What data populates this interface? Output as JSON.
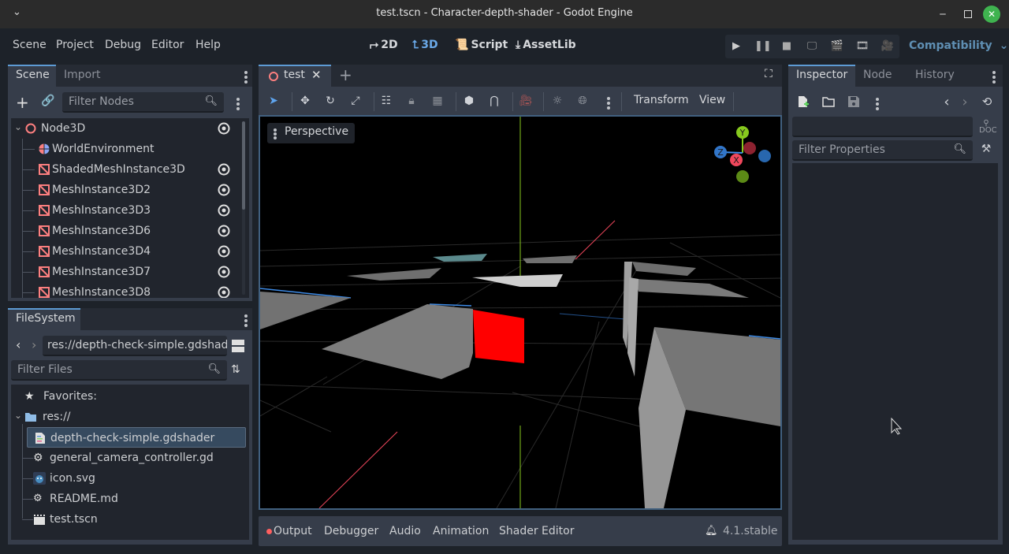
{
  "window": {
    "title": "test.tscn - Character-depth-shader - Godot Engine",
    "controls": {
      "minimize": "‒",
      "maximize": "☐",
      "close": "✕"
    }
  },
  "menubar": {
    "items": [
      "Scene",
      "Project",
      "Debug",
      "Editor",
      "Help"
    ],
    "workspaces": [
      {
        "label": "2D",
        "icon": "2d-icon",
        "active": false
      },
      {
        "label": "3D",
        "icon": "3d-icon",
        "active": true
      },
      {
        "label": "Script",
        "icon": "script-icon",
        "active": false
      },
      {
        "label": "AssetLib",
        "icon": "download-icon",
        "active": false
      }
    ],
    "run_buttons": [
      "play-icon",
      "pause-icon",
      "stop-icon",
      "remote-debug-icon",
      "play-scene-icon",
      "play-custom-scene-icon",
      "movie-maker-icon"
    ],
    "renderer": "Compatibility"
  },
  "scene_dock": {
    "tabs": [
      "Scene",
      "Import"
    ],
    "active_tab": "Scene",
    "filter_placeholder": "Filter Nodes",
    "nodes": [
      {
        "name": "Node3D",
        "icon": "node3d-icon",
        "visible_toggle": true,
        "root": true
      },
      {
        "name": "WorldEnvironment",
        "icon": "world-environment-icon",
        "visible_toggle": false
      },
      {
        "name": "ShadedMeshInstance3D",
        "icon": "mesh-instance-icon",
        "visible_toggle": true
      },
      {
        "name": "MeshInstance3D2",
        "icon": "mesh-instance-icon",
        "visible_toggle": true
      },
      {
        "name": "MeshInstance3D3",
        "icon": "mesh-instance-icon",
        "visible_toggle": true
      },
      {
        "name": "MeshInstance3D6",
        "icon": "mesh-instance-icon",
        "visible_toggle": true
      },
      {
        "name": "MeshInstance3D4",
        "icon": "mesh-instance-icon",
        "visible_toggle": true
      },
      {
        "name": "MeshInstance3D7",
        "icon": "mesh-instance-icon",
        "visible_toggle": true
      },
      {
        "name": "MeshInstance3D8",
        "icon": "mesh-instance-icon",
        "visible_toggle": true
      }
    ]
  },
  "filesystem_dock": {
    "tab": "FileSystem",
    "path": "res://depth-check-simple.gdshad",
    "filter_placeholder": "Filter Files",
    "favorites_label": "Favorites:",
    "root_label": "res://",
    "files": [
      {
        "name": "depth-check-simple.gdshader",
        "icon": "shader-file-icon",
        "selected": true
      },
      {
        "name": "general_camera_controller.gd",
        "icon": "gear-icon",
        "selected": false
      },
      {
        "name": "icon.svg",
        "icon": "godot-icon",
        "selected": false
      },
      {
        "name": "README.md",
        "icon": "text-file-icon",
        "selected": false
      },
      {
        "name": "test.tscn",
        "icon": "scene-file-icon",
        "selected": false
      }
    ]
  },
  "editor": {
    "scene_tab": "test",
    "toolbar": {
      "transform_label": "Transform",
      "view_label": "View"
    },
    "viewport": {
      "perspective_label": "Perspective",
      "gizmo_axes": [
        "Y",
        "Z",
        "X"
      ],
      "colors": {
        "x_axis": "#f0475c",
        "y_axis": "#87c91e",
        "z_axis": "#2f79d4",
        "highlight_cube": "#ff0000"
      }
    }
  },
  "bottom_panel": {
    "tabs": [
      "Output",
      "Debugger",
      "Audio",
      "Animation",
      "Shader Editor"
    ],
    "output_indicator_color": "#ff5f5f",
    "version": "4.1.stable"
  },
  "inspector": {
    "tabs": [
      "Inspector",
      "Node",
      "History"
    ],
    "active_tab": "Inspector",
    "filter_placeholder": "Filter Properties"
  }
}
